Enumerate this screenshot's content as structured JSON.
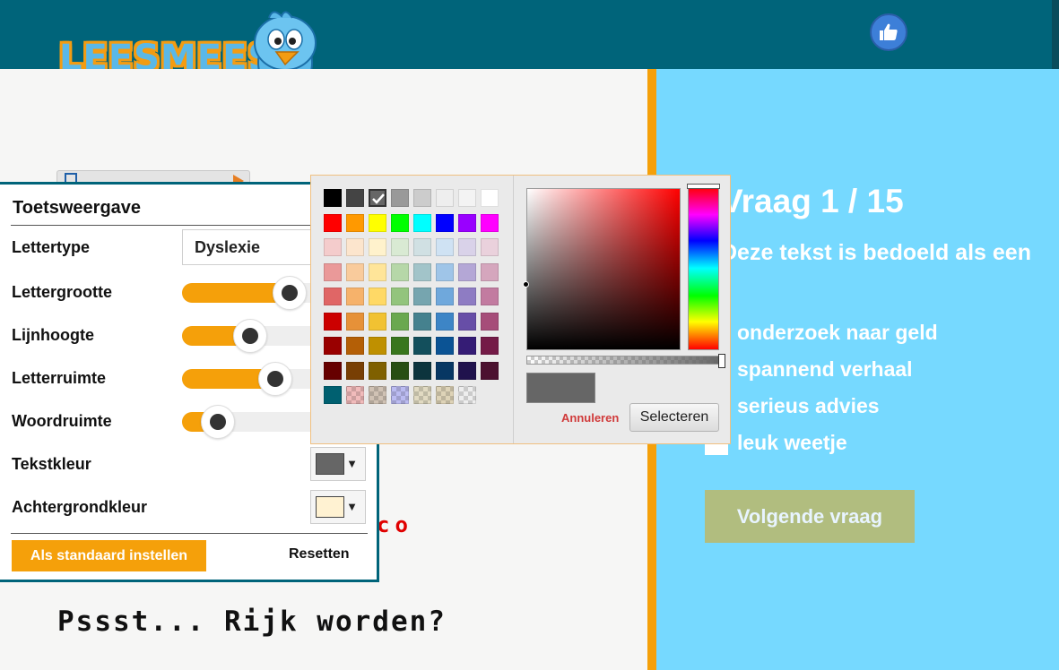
{
  "header": {
    "logo_text": "LEESMEES",
    "like_icon": "thumbs-up-icon",
    "colors": {
      "bar": "#00647a",
      "like": "#3d7fd8"
    }
  },
  "question": {
    "title": "Vraag 1 / 15",
    "text": "Deze tekst is bedoeld als een",
    "options": [
      "onderzoek naar geld",
      "spannend verhaal",
      "serieus advies",
      "leuk weetje"
    ],
    "next_label": "Volgende vraag",
    "colors": {
      "panel": "#76d9ff",
      "next": "#b1bd7f"
    }
  },
  "story": {
    "red_fragment": "co",
    "title": "Pssst... Rijk worden?"
  },
  "settings": {
    "title": "Toetsweergave",
    "font_label": "Lettertype",
    "font_value": "Dyslexie",
    "sliders": [
      {
        "label": "Lettergrootte",
        "value": 0.6
      },
      {
        "label": "Lijnhoogte",
        "value": 0.38
      },
      {
        "label": "Letterruimte",
        "value": 0.52
      },
      {
        "label": "Woordruimte",
        "value": 0.2
      }
    ],
    "text_color_label": "Tekstkleur",
    "text_color": "#666666",
    "bg_color_label": "Achtergrondkleur",
    "bg_color": "#fff2d2",
    "default_button": "Als standaard instellen",
    "reset_button": "Resetten",
    "accent": "#f5a00a"
  },
  "color_picker": {
    "palette": [
      [
        "#000000",
        "#444444",
        "#666666",
        "#999999",
        "#cccccc",
        "#eeeeee",
        "#f3f3f3",
        "#ffffff"
      ],
      [
        "#ff0000",
        "#ff9900",
        "#ffff00",
        "#00ff00",
        "#00ffff",
        "#0000ff",
        "#9900ff",
        "#ff00ff"
      ],
      [
        "#f4cccc",
        "#fce5cd",
        "#fff2cc",
        "#d9ead3",
        "#d0e0e3",
        "#cfe2f3",
        "#d9d2e9",
        "#ead1dc"
      ],
      [
        "#ea9999",
        "#f9cb9c",
        "#ffe599",
        "#b6d7a8",
        "#a2c4c9",
        "#9fc5e8",
        "#b4a7d6",
        "#d5a6bd"
      ],
      [
        "#e06666",
        "#f6b26b",
        "#ffd966",
        "#93c47d",
        "#76a5af",
        "#6fa8dc",
        "#8e7cc3",
        "#c27ba0"
      ],
      [
        "#cc0000",
        "#e69138",
        "#f1c232",
        "#6aa84f",
        "#45818e",
        "#3d85c6",
        "#674ea7",
        "#a64d79"
      ],
      [
        "#990000",
        "#b45f06",
        "#bf9000",
        "#38761d",
        "#134f5c",
        "#0b5394",
        "#351c75",
        "#741b47"
      ],
      [
        "#660000",
        "#783f04",
        "#7f6000",
        "#274e13",
        "#0c343d",
        "#073763",
        "#20124d",
        "#4c1130"
      ],
      [
        "#006070",
        "rgba(255,100,100,0.35)",
        "rgba(160,120,80,0.35)",
        "rgba(100,100,255,0.35)",
        "rgba(210,190,120,0.35)",
        "rgba(200,170,90,0.35)",
        "transparent"
      ]
    ],
    "selected": [
      0,
      2
    ],
    "hue": "#ff0000",
    "current": "#666666",
    "cancel_label": "Annuleren",
    "select_label": "Selecteren"
  }
}
